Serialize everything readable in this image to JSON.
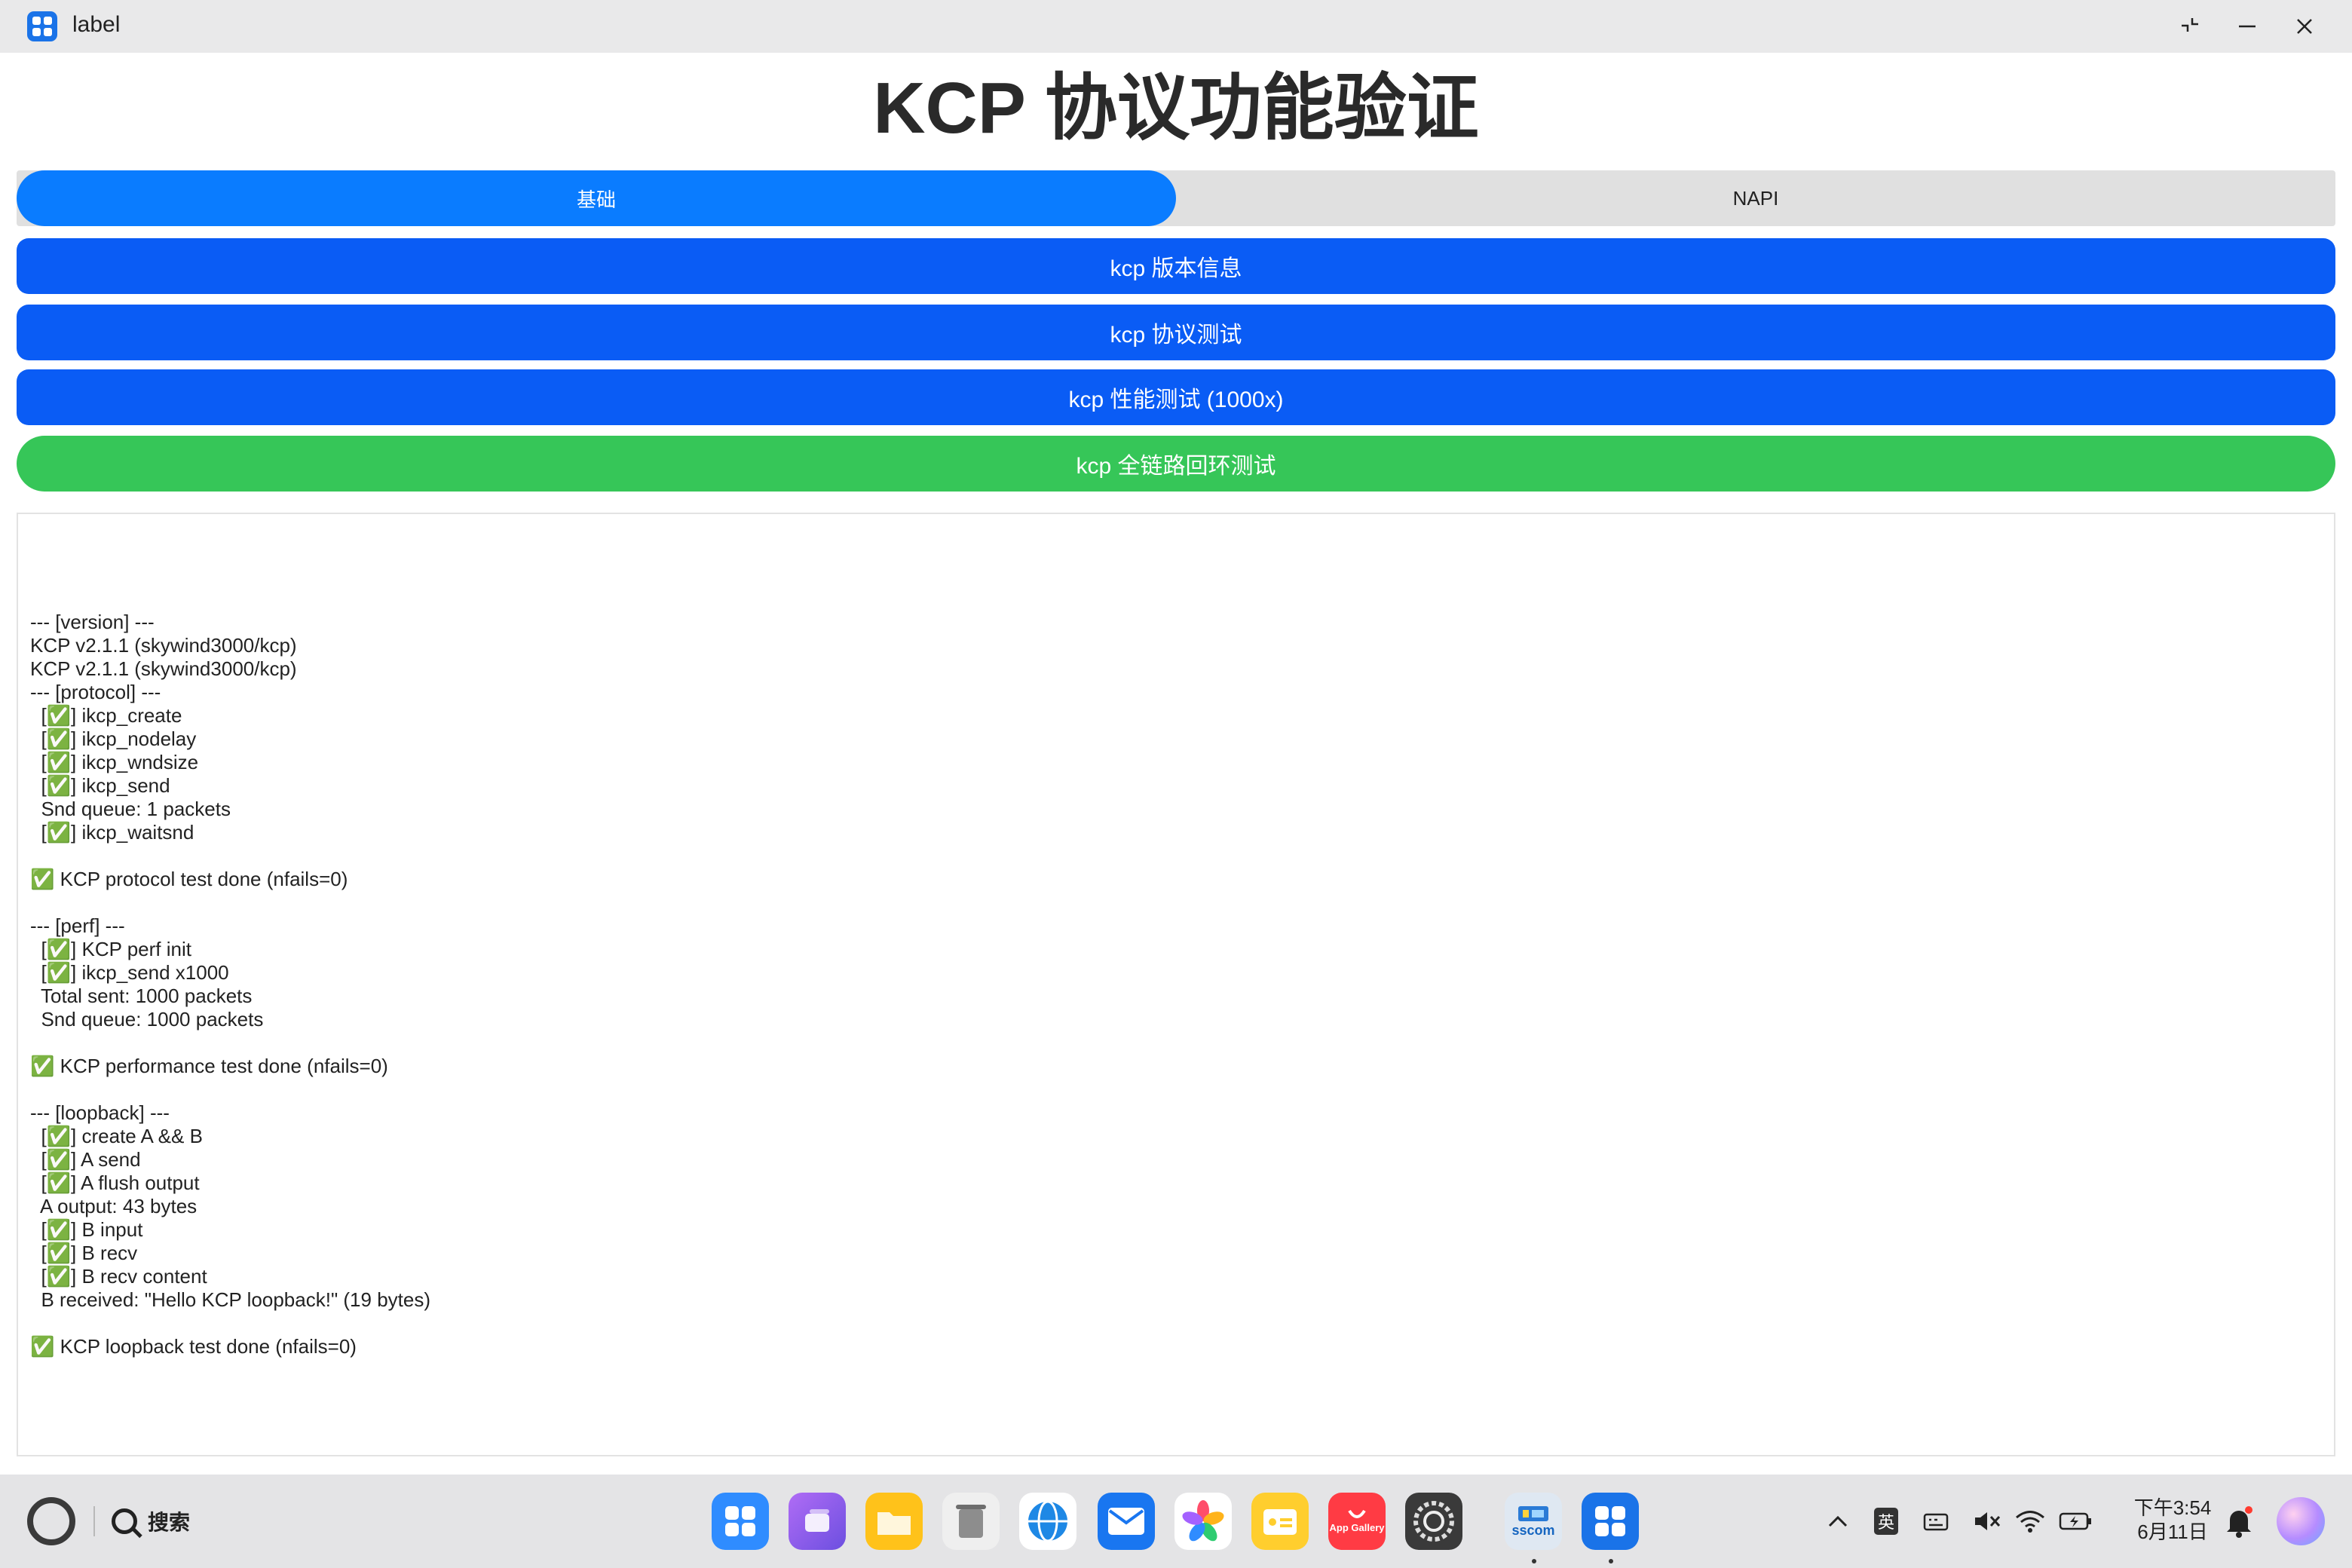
{
  "window": {
    "title": "label",
    "controls": [
      "restore-icon",
      "minimize-icon",
      "close-icon"
    ]
  },
  "main": {
    "title": "KCP 协议功能验证",
    "tabs": [
      {
        "label": "基础",
        "active": true
      },
      {
        "label": "NAPI",
        "active": false
      }
    ],
    "buttons": [
      {
        "label": "kcp 版本信息",
        "color": "#0a5cf5"
      },
      {
        "label": "kcp 协议测试",
        "color": "#0a5cf5"
      },
      {
        "label": "kcp 性能测试 (1000x)",
        "color": "#0a5cf5"
      },
      {
        "label": "kcp 全链路回环测试",
        "color": "#36c658"
      }
    ],
    "log": [
      "--- [version] ---",
      "KCP v2.1.1 (skywind3000/kcp)",
      "KCP v2.1.1 (skywind3000/kcp)",
      "--- [protocol] ---",
      "  [✅] ikcp_create",
      "  [✅] ikcp_nodelay",
      "  [✅] ikcp_wndsize",
      "  [✅] ikcp_send",
      "  Snd queue: 1 packets",
      "  [✅] ikcp_waitsnd",
      "",
      "✅ KCP protocol test done (nfails=0)",
      "",
      "--- [perf] ---",
      "  [✅] KCP perf init",
      "  [✅] ikcp_send x1000",
      "  Total sent: 1000 packets",
      "  Snd queue: 1000 packets",
      "",
      "✅ KCP performance test done (nfails=0)",
      "",
      "--- [loopback] ---",
      "  [✅] create A && B",
      "  [✅] A send",
      "  [✅] A flush output",
      "  A output: 43 bytes",
      "  [✅] B input",
      "  [✅] B recv",
      "  [✅] B recv content",
      "  B received: \"Hello KCP loopback!\" (19 bytes)",
      "",
      "✅ KCP loopback test done (nfails=0)"
    ]
  },
  "taskbar": {
    "search_label": "搜索",
    "dock_apps": [
      {
        "name": "app-center-icon",
        "color": "#2f8cff"
      },
      {
        "name": "multitask-icon",
        "color": "#8a5cf0"
      },
      {
        "name": "files-icon",
        "color": "#ffc21a"
      },
      {
        "name": "trash-icon",
        "color": "#9a9a9a"
      },
      {
        "name": "browser-icon",
        "color": "#1e88e5"
      },
      {
        "name": "mail-icon",
        "color": "#1976f0"
      },
      {
        "name": "gallery-icon",
        "color": "#ffffff"
      },
      {
        "name": "notes-icon",
        "color": "#ffce2e"
      },
      {
        "name": "app-gallery-icon",
        "color": "#ff3b44",
        "text": "App Gallery"
      },
      {
        "name": "settings-icon",
        "color": "#5a5a5a"
      },
      {
        "name": "sscom-icon",
        "color": "#dfe8f2",
        "text": "sscom"
      },
      {
        "name": "label-app-icon",
        "color": "#1a73e8"
      }
    ],
    "tray": {
      "ime_label": "英",
      "time": "下午3:54",
      "date": "6月11日"
    }
  }
}
